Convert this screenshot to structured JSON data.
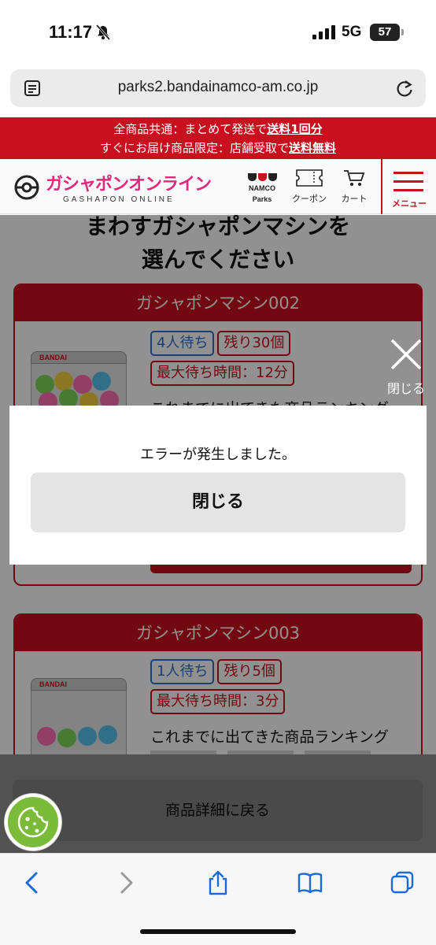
{
  "status_bar": {
    "time": "11:17",
    "network": "5G",
    "battery": "57"
  },
  "browser": {
    "url": "parks2.bandainamco-am.co.jp"
  },
  "promo": {
    "line1_prefix": "全商品共通：まとめて発送で",
    "line1_emph": "送料1回分",
    "line2_prefix": "すぐにお届け商品限定：店舗受取で",
    "line2_emph": "送料無料"
  },
  "header": {
    "brand": "ガシャポンオンライン",
    "brand_sub": "GASHAPON ONLINE",
    "namco_text1": "NAMCO",
    "namco_text2": "Parks",
    "coupon_label": "クーポン",
    "cart_label": "カート",
    "menu_label": "メニュー"
  },
  "page": {
    "heading_line1": "まわすガシャポンマシンを",
    "heading_line2": "選んでください"
  },
  "machines": [
    {
      "title": "ガシャポンマシン002",
      "wait_tag": "4人待ち",
      "stock_tag": "残り30個",
      "max_wait_tag": "最大待ち時間：12分",
      "ranking_title": "これまでに出てきた商品ランキング"
    },
    {
      "title": "ガシャポンマシン003",
      "wait_tag": "1人待ち",
      "stock_tag": "残り5個",
      "max_wait_tag": "最大待ち時間：3分",
      "ranking_title": "これまでに出てきた商品ランキング"
    }
  ],
  "machine_brand": "BANDAI",
  "back_button_label": "商品詳細に戻る",
  "modal": {
    "close_label": "閉じる",
    "message": "エラーが発生しました。",
    "button_label": "閉じる"
  },
  "colors": {
    "brand_red": "#c8101e",
    "tag_blue": "#2f6fcb",
    "cookie_green": "#7bbb3a"
  },
  "icons": [
    "bell-slash-icon",
    "signal-icon",
    "reader-icon",
    "reload-icon",
    "coupon-icon",
    "cart-icon",
    "hamburger-icon",
    "close-icon",
    "cookie-icon",
    "back-icon",
    "forward-icon",
    "share-icon",
    "bookmarks-icon",
    "tabs-icon"
  ]
}
